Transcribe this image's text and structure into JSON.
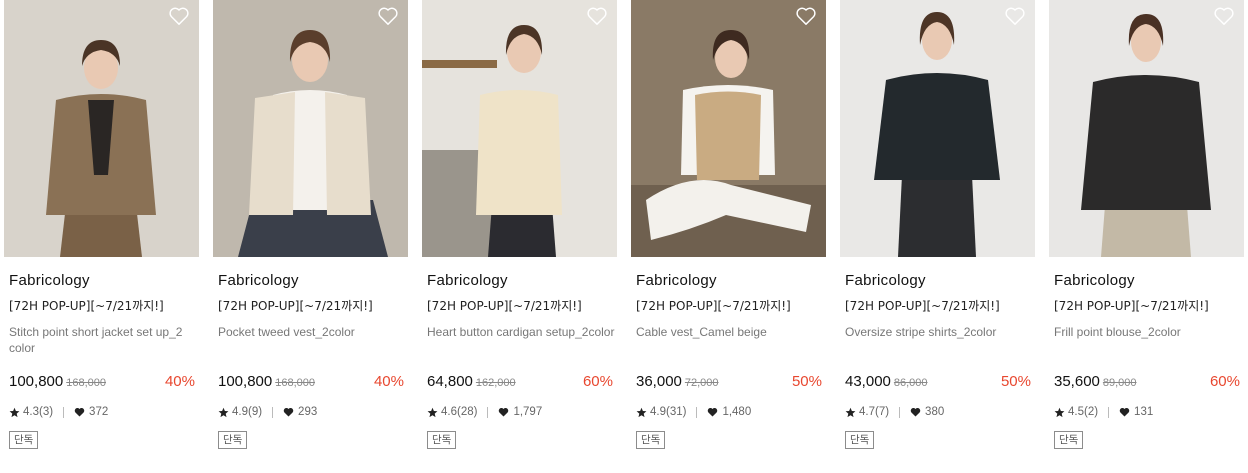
{
  "products": [
    {
      "brand": "Fabricology",
      "tag": "[72H POP-UP][~7/21까지!]",
      "name": "Stitch point short jacket set up_2 color",
      "price": "100,800",
      "original_price": "168,000",
      "discount": "40%",
      "rating": "4.3(3)",
      "likes": "372",
      "badge": "단독",
      "image": {
        "bg": "#d8d3cb",
        "garment": "#8a7155",
        "inner": "#2a2624",
        "hair": "#4a3426",
        "legs": "#7a6147"
      }
    },
    {
      "brand": "Fabricology",
      "tag": "[72H POP-UP][~7/21까지!]",
      "name": "Pocket tweed vest_2color",
      "price": "100,800",
      "original_price": "168,000",
      "discount": "40%",
      "rating": "4.9(9)",
      "likes": "293",
      "badge": "단독",
      "image": {
        "bg": "#bfb8ad",
        "garment": "#e7ddcc",
        "inner": "#f4f1ec",
        "hair": "#5a3e2c",
        "legs": "#3a3f4a"
      }
    },
    {
      "brand": "Fabricology",
      "tag": "[72H POP-UP][~7/21까지!]",
      "name": "Heart button cardigan setup_2color",
      "price": "64,800",
      "original_price": "162,000",
      "discount": "60%",
      "rating": "4.6(28)",
      "likes": "1,797",
      "badge": "단독",
      "image": {
        "bg": "#e6e3dd",
        "garment": "#efe3c8",
        "inner": "#efe3c8",
        "hair": "#4c3526",
        "legs": "#2b2b30"
      }
    },
    {
      "brand": "Fabricology",
      "tag": "[72H POP-UP][~7/21까지!]",
      "name": "Cable vest_Camel beige",
      "price": "36,000",
      "original_price": "72,000",
      "discount": "50%",
      "rating": "4.9(31)",
      "likes": "1,480",
      "badge": "단독",
      "image": {
        "bg": "#8a7a66",
        "garment": "#c9ab82",
        "inner": "#f5f3ef",
        "hair": "#3e2a20",
        "legs": "#f3f1ec"
      }
    },
    {
      "brand": "Fabricology",
      "tag": "[72H POP-UP][~7/21까지!]",
      "name": "Oversize stripe shirts_2color",
      "price": "43,000",
      "original_price": "86,000",
      "discount": "50%",
      "rating": "4.7(7)",
      "likes": "380",
      "badge": "단독",
      "image": {
        "bg": "#e9e8e6",
        "garment": "#23292d",
        "inner": "#23292d",
        "hair": "#4d3526",
        "legs": "#2c2d30"
      }
    },
    {
      "brand": "Fabricology",
      "tag": "[72H POP-UP][~7/21까지!]",
      "name": "Frill point blouse_2color",
      "price": "35,600",
      "original_price": "89,000",
      "discount": "60%",
      "rating": "4.5(2)",
      "likes": "131",
      "badge": "단독",
      "image": {
        "bg": "#e8e7e5",
        "garment": "#2b2a2a",
        "inner": "#2b2a2a",
        "hair": "#4a3124",
        "legs": "#c3b9a6"
      }
    }
  ],
  "icons": {
    "wishlist": "heart-outline-icon",
    "rating": "star-icon",
    "likes": "heart-filled-icon"
  },
  "colors": {
    "discount": "#e8472f"
  }
}
